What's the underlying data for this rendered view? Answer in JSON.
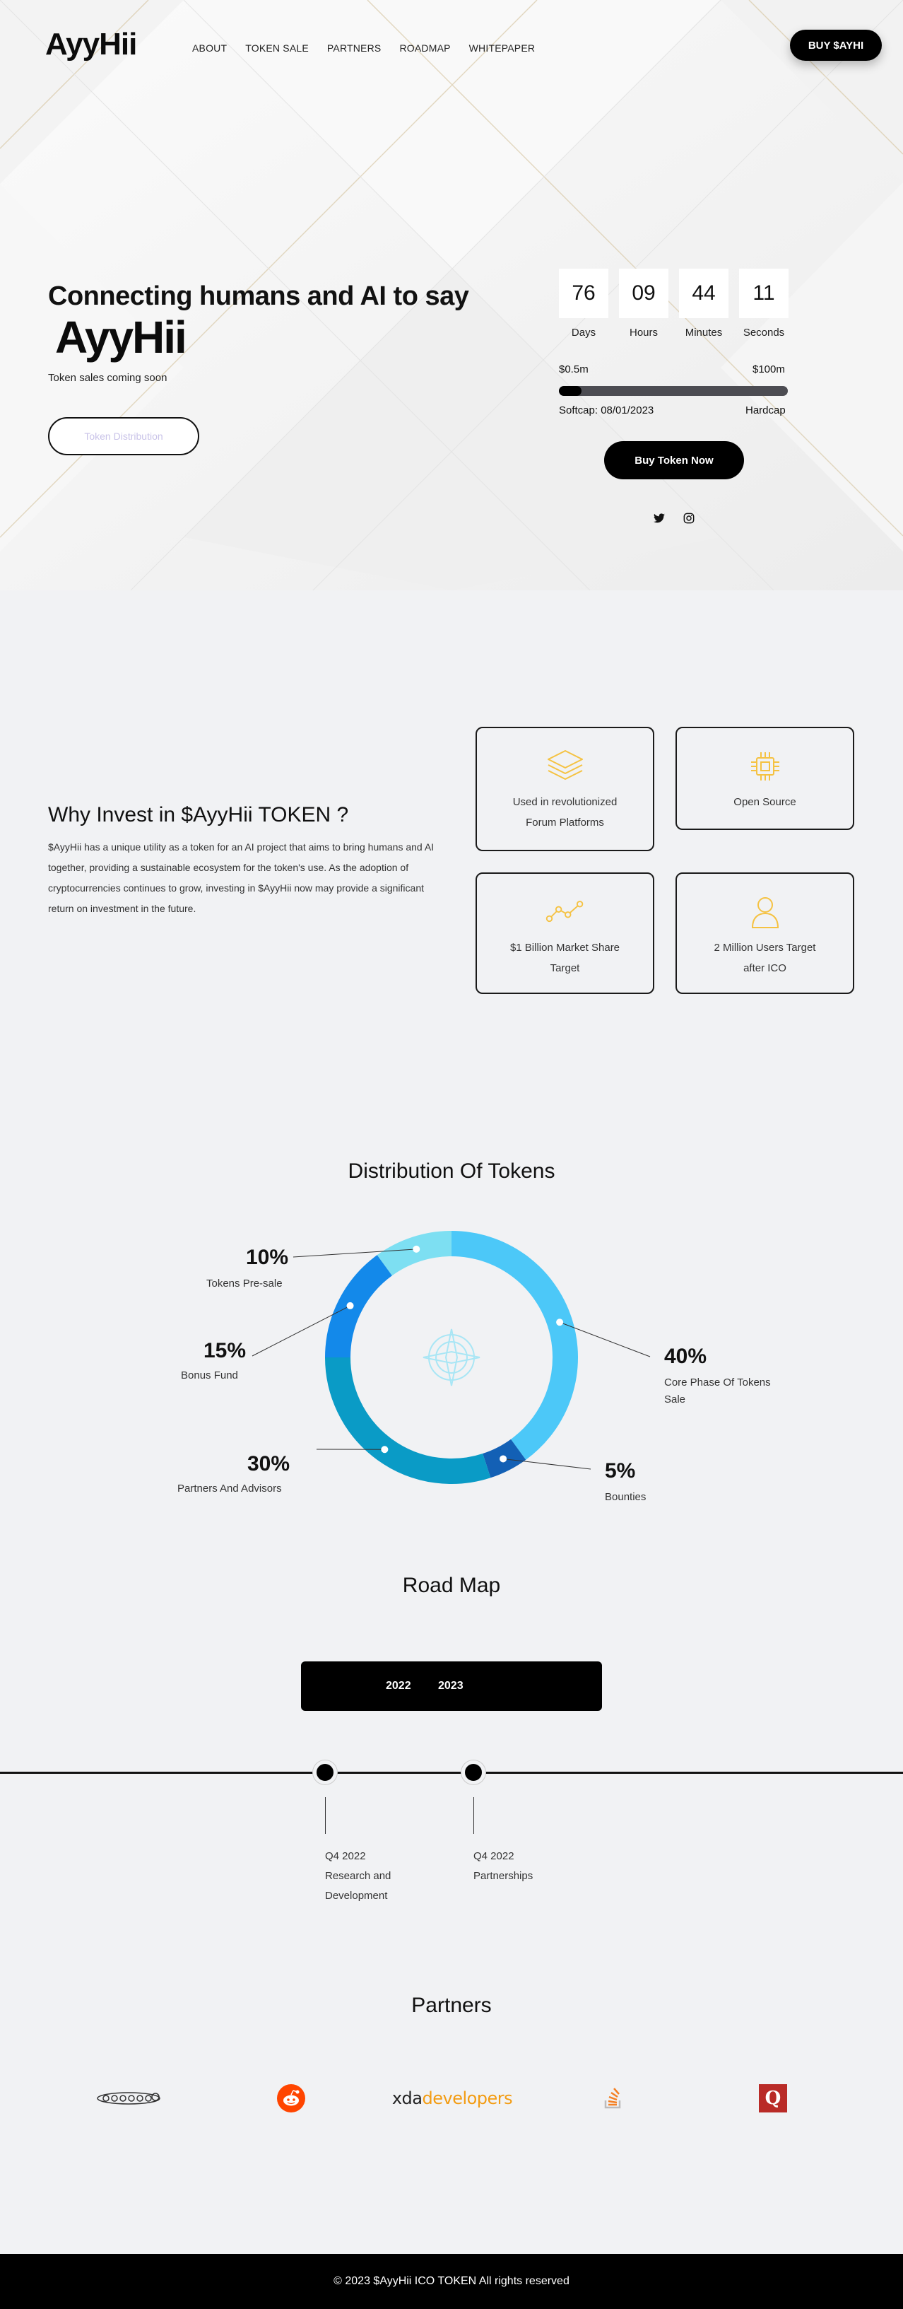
{
  "nav": {
    "logo": "AyyHii",
    "links": [
      "ABOUT",
      "TOKEN SALE",
      "PARTNERS",
      "ROADMAP",
      "WHITEPAPER"
    ],
    "buy_label": "BUY $AYHI"
  },
  "hero": {
    "title": "Connecting humans and AI to say",
    "brand": "AyyHii",
    "subtitle": "Token sales coming soon",
    "distribution_button": "Token Distribution",
    "countdown": [
      {
        "value": "76",
        "label": "Days"
      },
      {
        "value": "09",
        "label": "Hours"
      },
      {
        "value": "44",
        "label": "Minutes"
      },
      {
        "value": "11",
        "label": "Seconds"
      }
    ],
    "raise_min": "$0.5m",
    "raise_max": "$100m",
    "progress_fraction": 0.1,
    "softcap": "Softcap: 08/01/2023",
    "hardcap": "Hardcap",
    "buy_now": "Buy Token Now",
    "social": [
      "twitter-icon",
      "instagram-icon"
    ]
  },
  "why": {
    "title": "Why Invest in $AyyHii TOKEN ?",
    "text": "$AyyHii has a unique utility as a token for an AI project that aims to bring humans and AI together, providing a sustainable ecosystem for the token's use. As the adoption of cryptocurrencies continues to grow, investing in $AyyHii now may provide a significant return on investment in the future.",
    "cards": [
      {
        "icon": "layers-icon",
        "label": "Used in revolutionized Forum Platforms"
      },
      {
        "icon": "chip-icon",
        "label": "Open Source"
      },
      {
        "icon": "graph-icon",
        "label": "$1 Billion Market Share Target"
      },
      {
        "icon": "user-icon",
        "label": "2 Million Users Target after ICO"
      }
    ],
    "accent": "#f5c242"
  },
  "distribution": {
    "title": "Distribution Of Tokens",
    "center_icon": "compass-icon",
    "segments": [
      {
        "pct": "40%",
        "label": "Core Phase Of Tokens Sale",
        "value": 40,
        "color": "#4cc8f8"
      },
      {
        "pct": "5%",
        "label": "Bounties",
        "value": 5,
        "color": "#1360b5"
      },
      {
        "pct": "30%",
        "label": "Partners And Advisors",
        "value": 30,
        "color": "#0a9bc6"
      },
      {
        "pct": "15%",
        "label": "Bonus Fund",
        "value": 15,
        "color": "#1389ea"
      },
      {
        "pct": "10%",
        "label": "Tokens Pre-sale",
        "value": 10,
        "color": "#7ddff2"
      }
    ]
  },
  "roadmap": {
    "title": "Road Map",
    "years": [
      "2022",
      "2023"
    ],
    "items": [
      {
        "quarter": "Q4 2022",
        "text": "Research and Development"
      },
      {
        "quarter": "Q4 2022",
        "text": "Partnerships"
      }
    ]
  },
  "partners": {
    "title": "Partners",
    "logos": [
      "coinmarketcap-logo",
      "reddit-logo",
      "xda-developers-logo",
      "stackoverflow-logo",
      "quora-logo"
    ],
    "xda_left": "xda",
    "xda_right": "developers",
    "quora_letter": "Q"
  },
  "footer": {
    "text": "© 2023 $AyyHii ICO TOKEN All rights reserved"
  }
}
